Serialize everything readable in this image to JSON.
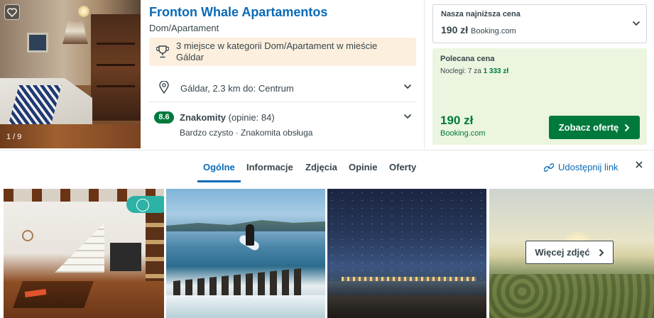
{
  "gallery_main": {
    "counter": "1 / 9",
    "favorite_icon": "heart-icon"
  },
  "hotel": {
    "name": "Fronton Whale Apartamentos",
    "type": "Dom/Apartament",
    "badge_text": "3 miejsce w kategorii Dom/Apartament w mieście Gáldar",
    "location_text": "Gáldar, 2.3 km do: Centrum",
    "rating": {
      "score": "8.6",
      "label": "Znakomity",
      "reviews": " (opinie: 84)",
      "highlights": "Bardzo czysto · Znakomita obsługa"
    }
  },
  "deal": {
    "lowest_label": "Nasza najniższa cena",
    "lowest_price": "190 zł",
    "lowest_provider": "Booking.com",
    "recommended_label": "Polecana cena",
    "nights_prefix": "Noclegi: 7 za ",
    "nights_total": "1 333 zł",
    "price": "190 zł",
    "provider": "Booking.com",
    "cta": "Zobacz ofertę"
  },
  "tabs": {
    "items": [
      "Ogólne",
      "Informacje",
      "Zdjęcia",
      "Opinie",
      "Oferty"
    ],
    "active_index": 0,
    "share_label": "Udostępnij link"
  },
  "gallery": {
    "more_label": "Więcej zdjęć"
  },
  "colors": {
    "brand_blue": "#0a6ab6",
    "deal_green": "#007a3c",
    "badge_bg": "#fcefde",
    "deal_bg": "#ebf5df"
  }
}
